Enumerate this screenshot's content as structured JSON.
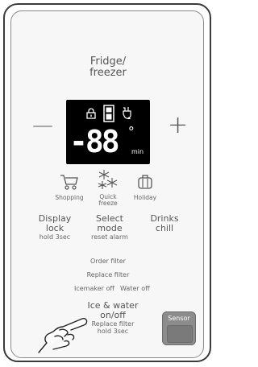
{
  "panel": {
    "fridge_freezer": {
      "line1": "Fridge/",
      "line2": "freezer"
    },
    "display": {
      "digits": "-88",
      "degree": "°",
      "unit": "min"
    },
    "minus_label": "—",
    "plus_label": "+",
    "icons": {
      "shopping": "Shopping",
      "quick_freeze": {
        "line1": "Quick",
        "line2": "freeze"
      },
      "holiday": "Holiday"
    },
    "display_lock": {
      "line1": "Display",
      "line2": "lock",
      "sub": "hold 3sec"
    },
    "select_mode": {
      "line1": "Select",
      "line2": "mode",
      "sub": "reset alarm"
    },
    "drinks_chill": {
      "line1": "Drinks",
      "line2": "chill"
    },
    "order_filter": "Order filter",
    "replace_filter": "Replace filter",
    "icemaker_off": "Icemaker off",
    "water_off": "Water off",
    "ice_water": {
      "line1": "Ice & water",
      "line2": "on/off",
      "sub1": "Replace filter",
      "sub2": "hold 3sec"
    },
    "sensor_label": "Sensor"
  }
}
